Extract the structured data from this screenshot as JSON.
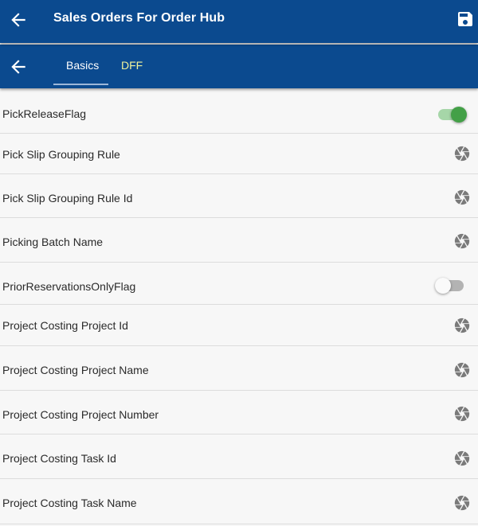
{
  "header": {
    "title": "Sales Orders For Order Hub"
  },
  "tabs": {
    "basics": "Basics",
    "dff": "DFF",
    "active": "basics"
  },
  "fields": [
    {
      "label": "PickReleaseFlag",
      "type": "toggle",
      "on": true
    },
    {
      "label": "Pick Slip Grouping Rule",
      "type": "lov"
    },
    {
      "label": "Pick Slip Grouping Rule Id",
      "type": "lov"
    },
    {
      "label": "Picking Batch Name",
      "type": "lov"
    },
    {
      "label": "PriorReservationsOnlyFlag",
      "type": "toggle",
      "on": false
    },
    {
      "label": "Project Costing Project Id",
      "type": "lov"
    },
    {
      "label": "Project Costing Project Name",
      "type": "lov"
    },
    {
      "label": "Project Costing Project Number",
      "type": "lov"
    },
    {
      "label": "Project Costing Task Id",
      "type": "lov"
    },
    {
      "label": "Project Costing Task Name",
      "type": "lov"
    }
  ],
  "colors": {
    "header_bg": "#0b4a8f",
    "tab_active_text": "#ffffff",
    "tab_inactive_text": "#f0f39c",
    "toggle_on": "#43a047",
    "toggle_off": "#b3b3b3",
    "icon_gray": "#7a7a7a"
  }
}
